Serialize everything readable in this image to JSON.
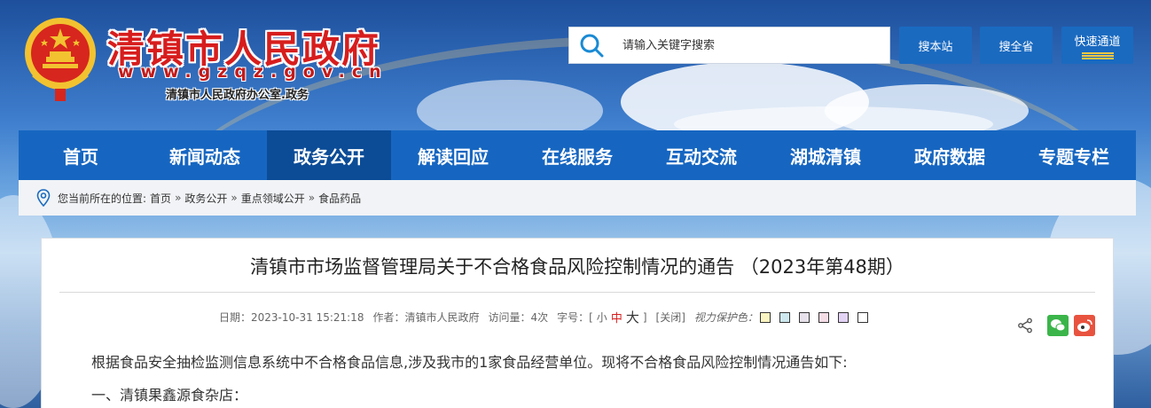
{
  "header": {
    "site_name": "清镇市人民政府",
    "domain": "www.gzqz.gov.cn",
    "subtitle": "清镇市人民政府办公室.政务",
    "search": {
      "placeholder": "请输入关键字搜索"
    },
    "buttons": {
      "search_site": "搜本站",
      "search_province": "搜全省",
      "quick_access": "快速通道"
    }
  },
  "nav": {
    "items": [
      {
        "label": "首页"
      },
      {
        "label": "新闻动态"
      },
      {
        "label": "政务公开",
        "active": true
      },
      {
        "label": "解读回应"
      },
      {
        "label": "在线服务"
      },
      {
        "label": "互动交流"
      },
      {
        "label": "湖城清镇"
      },
      {
        "label": "政府数据"
      },
      {
        "label": "专题专栏"
      }
    ]
  },
  "breadcrumb": {
    "prefix": "您当前所在的位置:",
    "items": [
      "首页",
      "政务公开",
      "重点领域公开",
      "食品药品"
    ],
    "separator": "»"
  },
  "article": {
    "title": "清镇市市场监督管理局关于不合格食品风险控制情况的通告 （2023年第48期）",
    "meta": {
      "date": "日期：2023-10-31 15:21:18",
      "author": "作者：清镇市人民政府",
      "views": "访问量：4次",
      "font_size_label": "字号：[",
      "font_small": "小",
      "font_medium": "中",
      "font_large": "大",
      "font_size_close": "]",
      "close": "[关闭]",
      "vision_label": "视力保护色："
    },
    "vision_colors": [
      "#fbf5c2",
      "#cde8ee",
      "#e6e1ea",
      "#f5dde6",
      "#e3d3f5",
      "#ffffff"
    ],
    "paragraphs": [
      "根据食品安全抽检监测信息系统中不合格食品信息,涉及我市的1家食品经营单位。现将不合格食品风险控制情况通告如下:",
      "一、清镇果鑫源食杂店："
    ]
  },
  "colors": {
    "nav_bg": "#1666c1",
    "nav_active": "#0c4c97",
    "brand_red": "#d71d1d",
    "button_blue": "#1a6ac0"
  }
}
